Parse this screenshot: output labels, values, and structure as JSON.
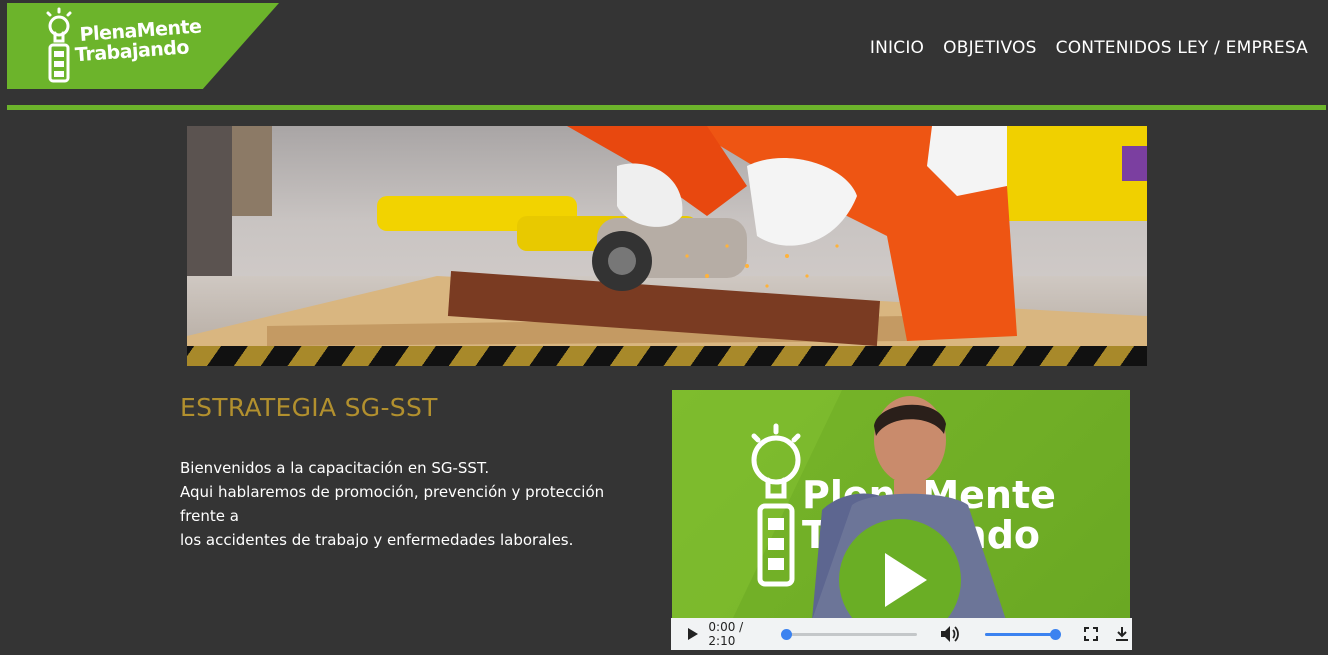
{
  "logo": {
    "line1": "PlenaMente",
    "line2": "Trabajando",
    "icon": "lightbulb-battery-icon"
  },
  "nav": {
    "items": [
      "INICIO",
      "OBJETIVOS",
      "CONTENIDOS LEY / EMPRESA"
    ]
  },
  "banner": {
    "icon": "worker-grinding-photo"
  },
  "section": {
    "title": "ESTRATEGIA SG-SST",
    "lines": [
      "Bienvenidos a la capacitación en SG-SST.",
      "Aqui hablaremos de promoción, prevención y protección frente a",
      "los accidentes de trabajo y enfermedades laborales."
    ]
  },
  "video": {
    "logo_line1": "PlenaMente",
    "logo_line2": "Trabajando",
    "time": "0:00 / 2:10",
    "progress": 0.0,
    "volume": 1.0
  },
  "colors": {
    "brand_green": "#6cb42b",
    "title_gold": "#b2902e",
    "background": "#343434",
    "accent_blue": "#3b82f0"
  }
}
